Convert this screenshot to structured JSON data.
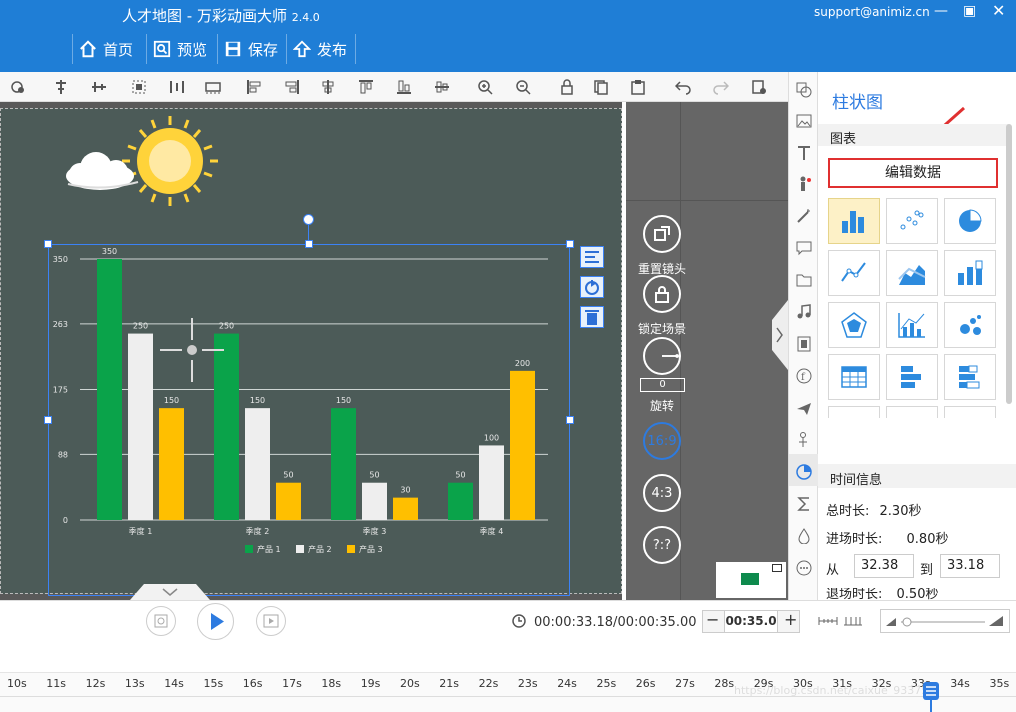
{
  "titlebar": {
    "title": "人才地图 - 万彩动画大师",
    "version": "2.4.0",
    "support": "support@animiz.cn",
    "nav": [
      "首页",
      "预览",
      "保存",
      "发布"
    ]
  },
  "stage_controls": {
    "reset_camera": "重置镜头",
    "lock_scene": "锁定场景",
    "rotate_value": "0",
    "rotate_label": "旋转",
    "ratio_16_9": "16:9",
    "ratio_4_3": "4:3",
    "ratio_custom": "?:?"
  },
  "panel": {
    "title": "柱状图",
    "section_chart": "图表",
    "edit_data_button": "编辑数据",
    "section_time": "时间信息",
    "total_label": "总时长:",
    "total_value": "2.30秒",
    "enter_label": "进场时长:",
    "enter_value": "0.80秒",
    "from_label": "从",
    "from_value": "32.38",
    "to_label": "到",
    "to_value": "33.18",
    "exit_label": "退场时长:",
    "exit_value": "0.50秒"
  },
  "playback": {
    "time_display": "00:00:33.18/00:00:35.00",
    "duration_value": "00:35.0",
    "minus": "−",
    "plus": "+"
  },
  "timeline": {
    "ticks": [
      "10s",
      "11s",
      "12s",
      "13s",
      "14s",
      "15s",
      "16s",
      "17s",
      "18s",
      "19s",
      "20s",
      "21s",
      "22s",
      "23s",
      "24s",
      "25s",
      "26s",
      "27s",
      "28s",
      "29s",
      "30s",
      "31s",
      "32s",
      "33s",
      "34s",
      "35s"
    ],
    "watermark": "https://blog.csdn.net/caixue_933759"
  },
  "chart_data": {
    "type": "bar",
    "categories": [
      "季度 1",
      "季度 2",
      "季度 3",
      "季度 4"
    ],
    "series": [
      {
        "name": "产品 1",
        "values": [
          350,
          250,
          150,
          50
        ],
        "color": "#0aa34a"
      },
      {
        "name": "产品 2",
        "values": [
          250,
          150,
          50,
          100
        ],
        "color": "#eeeeee"
      },
      {
        "name": "产品 3",
        "values": [
          150,
          50,
          30,
          200
        ],
        "color": "#ffbf00"
      }
    ],
    "y_ticks": [
      "0",
      "88",
      "175",
      "263",
      "350"
    ],
    "ylim": [
      0,
      350
    ],
    "grid": true,
    "legend": "bottom"
  }
}
